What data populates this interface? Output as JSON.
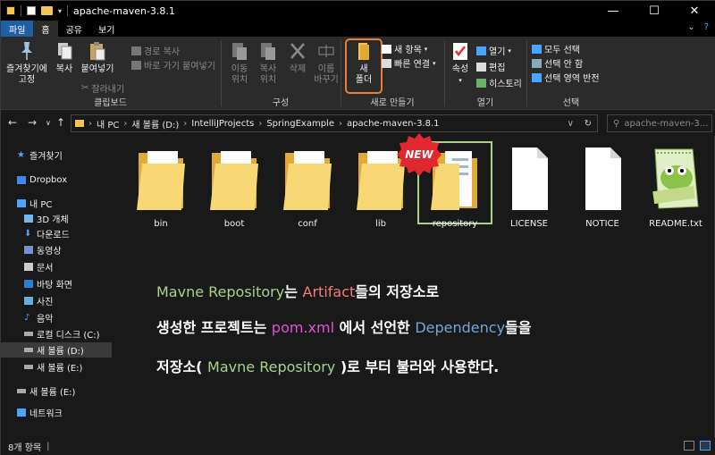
{
  "window": {
    "title": "apache-maven-3.8.1",
    "minimize": "—",
    "maximize": "☐",
    "close": "✕"
  },
  "tabs": {
    "file": "파일",
    "items": [
      "홈",
      "공유",
      "보기"
    ],
    "right_expand": "⌄",
    "right_help": "?"
  },
  "ribbon": {
    "clipboard": {
      "label": "클립보드",
      "pin": "즐겨찾기에\n고정",
      "copy": "복사",
      "paste": "붙여넣기",
      "copy_path": "경로 복사",
      "paste_shortcut": "바로 가기 붙여넣기",
      "cut": "잘라내기"
    },
    "organize": {
      "label": "구성",
      "move_to": "이동\n위치",
      "copy_to": "복사\n위치",
      "delete": "삭제",
      "rename": "이름\n바꾸기"
    },
    "new": {
      "label": "새로 만들기",
      "new_folder": "새\n폴더",
      "new_item": "새 항목",
      "easy_access": "빠른 연결"
    },
    "open": {
      "label": "열기",
      "properties": "속성",
      "open": "열기",
      "edit": "편집",
      "history": "히스토리"
    },
    "select": {
      "label": "선택",
      "select_all": "모두 선택",
      "select_none": "선택 안 함",
      "invert": "선택 영역 반전"
    }
  },
  "address": {
    "crumbs": [
      "내 PC",
      "새 볼륨 (D:)",
      "IntelliJProjects",
      "SpringExample",
      "apache-maven-3.8.1"
    ],
    "search_placeholder": "apache-maven-3..."
  },
  "sidebar": {
    "items": [
      {
        "label": "즐겨찾기",
        "icon": "star-icon"
      },
      {
        "label": "Dropbox",
        "icon": "dropbox-icon"
      },
      {
        "label": "내 PC",
        "icon": "pc-icon"
      },
      {
        "label": "3D 개체",
        "icon": "3d-objects-icon"
      },
      {
        "label": "다운로드",
        "icon": "download-icon"
      },
      {
        "label": "동영상",
        "icon": "video-icon"
      },
      {
        "label": "문서",
        "icon": "document-icon"
      },
      {
        "label": "바탕 화면",
        "icon": "desktop-icon"
      },
      {
        "label": "사진",
        "icon": "picture-icon"
      },
      {
        "label": "음악",
        "icon": "music-icon"
      },
      {
        "label": "로컬 디스크 (C:)",
        "icon": "drive-icon"
      },
      {
        "label": "새 볼륨 (D:)",
        "icon": "drive-icon"
      },
      {
        "label": "새 볼륨 (E:)",
        "icon": "drive-icon"
      },
      {
        "label": "새 볼륨 (E:)",
        "icon": "drive-icon"
      },
      {
        "label": "네트워크",
        "icon": "network-icon"
      }
    ]
  },
  "files": [
    {
      "name": "bin",
      "type": "folder"
    },
    {
      "name": "boot",
      "type": "folder"
    },
    {
      "name": "conf",
      "type": "folder"
    },
    {
      "name": "lib",
      "type": "folder"
    },
    {
      "name": "repository",
      "type": "folder"
    },
    {
      "name": "LICENSE",
      "type": "file"
    },
    {
      "name": "NOTICE",
      "type": "file"
    },
    {
      "name": "README.txt",
      "type": "notepad"
    }
  ],
  "badge": "NEW",
  "caption": {
    "line1": {
      "a": "Mavne Repository",
      "b": "는 ",
      "c": "Artifact",
      "d": "들의 저장소로"
    },
    "line2": {
      "a": "생성한 프로젝트는 ",
      "b": "pom.xml",
      "c": " 에서 선언한 ",
      "d": "Dependency",
      "e": "들을"
    },
    "line3": {
      "a": "저장소( ",
      "b": "Mavne Repository",
      "c": " )로 부터 불러와 사용한다."
    }
  },
  "status": {
    "count": "8개 항목"
  },
  "colors": {
    "accent_file_tab": "#1f5fa8",
    "highlight_orange": "#e8803a",
    "selection_green": "#a9d18e",
    "badge_red": "#e0282e",
    "folder": "#f3c552"
  }
}
